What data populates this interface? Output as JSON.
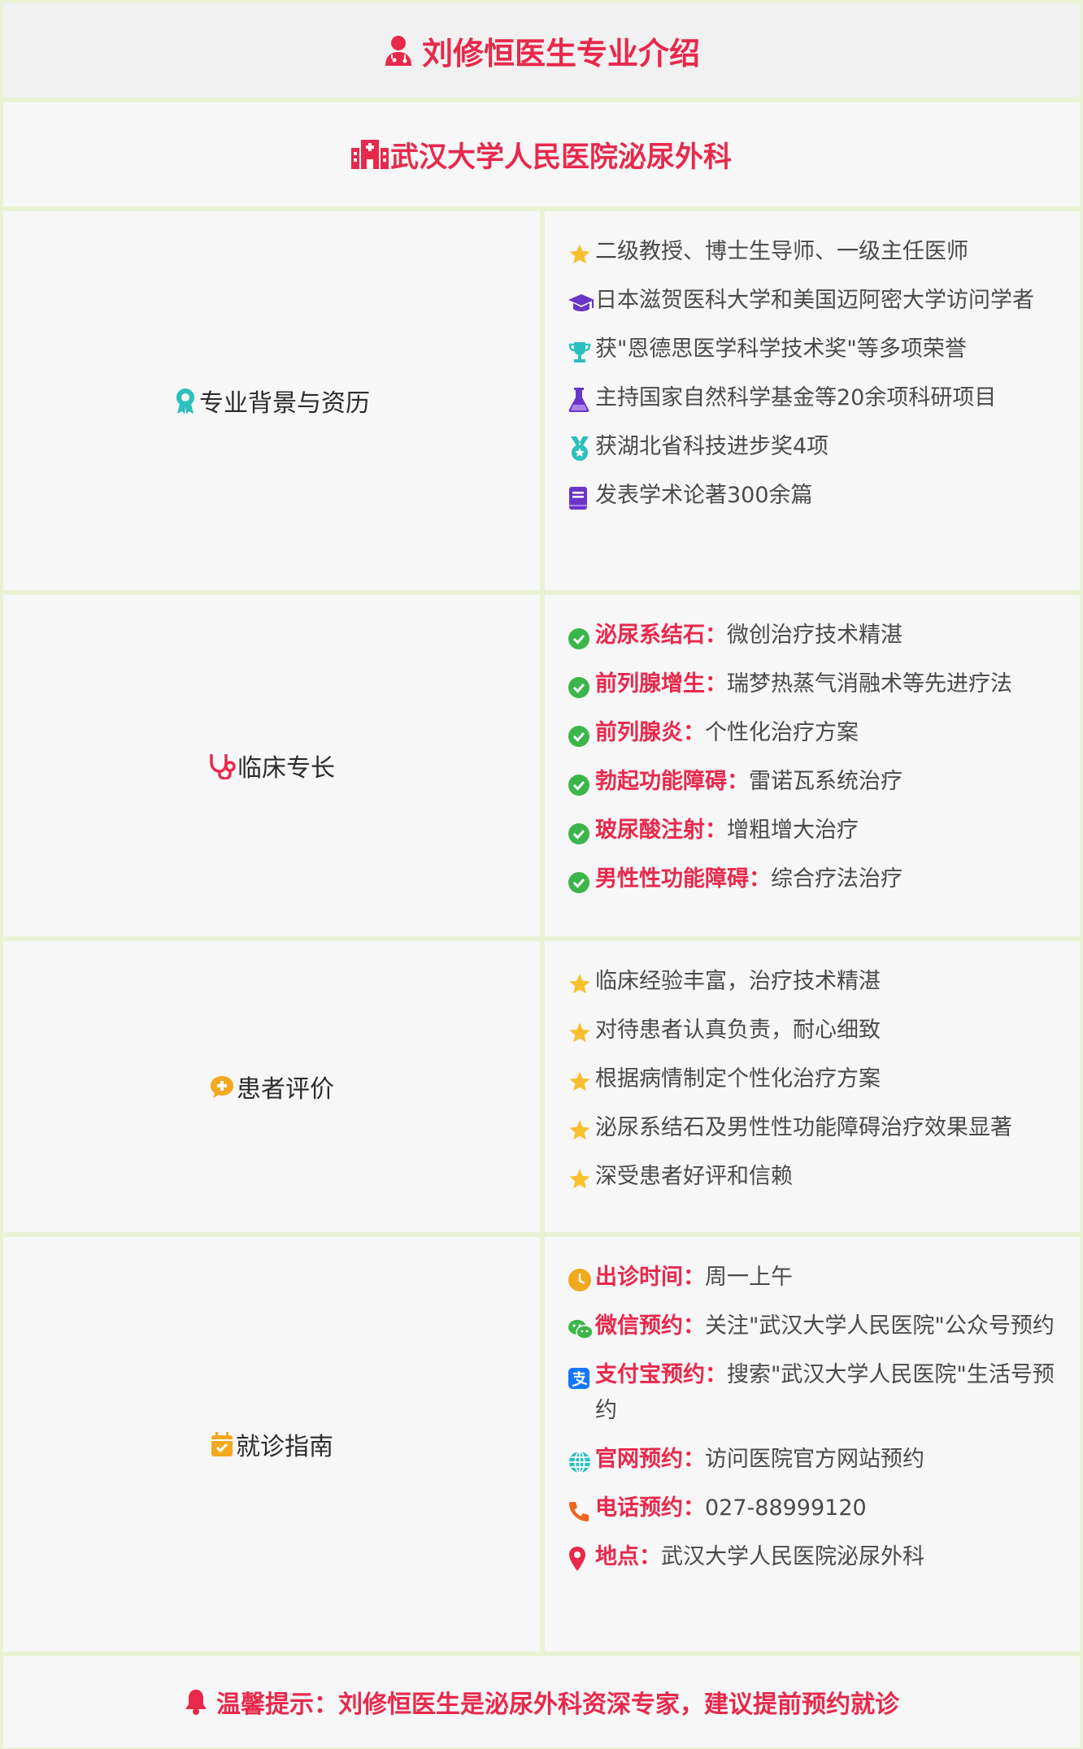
{
  "header": {
    "title": "刘修恒医生专业介绍",
    "hospital": "武汉大学人民医院泌尿外科"
  },
  "sections": [
    {
      "label": "专业背景与资历",
      "items": [
        {
          "icon": "star-icon",
          "text": "二级教授、博士生导师、一级主任医师"
        },
        {
          "icon": "graduation-cap-icon",
          "text": "日本滋贺医科大学和美国迈阿密大学访问学者"
        },
        {
          "icon": "trophy-icon",
          "text": "获\"恩德思医学科学技术奖\"等多项荣誉"
        },
        {
          "icon": "flask-icon",
          "text": "主持国家自然科学基金等20余项科研项目"
        },
        {
          "icon": "medal-icon",
          "text": "获湖北省科技进步奖4项"
        },
        {
          "icon": "book-icon",
          "text": "发表学术论著300余篇"
        }
      ]
    },
    {
      "label": "临床专长",
      "items": [
        {
          "icon": "check-circle-icon",
          "key": "泌尿系结石：",
          "text": "微创治疗技术精湛"
        },
        {
          "icon": "check-circle-icon",
          "key": "前列腺增生：",
          "text": "瑞梦热蒸气消融术等先进疗法"
        },
        {
          "icon": "check-circle-icon",
          "key": "前列腺炎：",
          "text": "个性化治疗方案"
        },
        {
          "icon": "check-circle-icon",
          "key": "勃起功能障碍：",
          "text": "雷诺瓦系统治疗"
        },
        {
          "icon": "check-circle-icon",
          "key": "玻尿酸注射：",
          "text": "增粗增大治疗"
        },
        {
          "icon": "check-circle-icon",
          "key": "男性性功能障碍：",
          "text": "综合疗法治疗"
        }
      ]
    },
    {
      "label": "患者评价",
      "items": [
        {
          "icon": "star-icon",
          "text": "临床经验丰富，治疗技术精湛"
        },
        {
          "icon": "star-icon",
          "text": "对待患者认真负责，耐心细致"
        },
        {
          "icon": "star-icon",
          "text": "根据病情制定个性化治疗方案"
        },
        {
          "icon": "star-icon",
          "text": "泌尿系结石及男性性功能障碍治疗效果显著"
        },
        {
          "icon": "star-icon",
          "text": "深受患者好评和信赖"
        }
      ]
    },
    {
      "label": "就诊指南",
      "items": [
        {
          "icon": "clock-icon",
          "key": "出诊时间：",
          "text": "周一上午"
        },
        {
          "icon": "wechat-icon",
          "key": "微信预约：",
          "text": "关注\"武汉大学人民医院\"公众号预约"
        },
        {
          "icon": "alipay-icon",
          "key": "支付宝预约：",
          "text": "搜索\"武汉大学人民医院\"生活号预约"
        },
        {
          "icon": "globe-icon",
          "key": "官网预约：",
          "text": "访问医院官方网站预约"
        },
        {
          "icon": "phone-icon",
          "key": "电话预约：",
          "text": "027-88999120"
        },
        {
          "icon": "location-pin-icon",
          "key": "地点：",
          "text": "武汉大学人民医院泌尿外科"
        }
      ]
    }
  ],
  "footer": {
    "text": "温馨提示：刘修恒医生是泌尿外科资深专家，建议提前预约就诊"
  },
  "colors": {
    "accent": "#e8294c",
    "border": "#e9f3d4",
    "panel": "#f7f7f7",
    "star": "#f9c02e",
    "check": "#3cb64a"
  }
}
